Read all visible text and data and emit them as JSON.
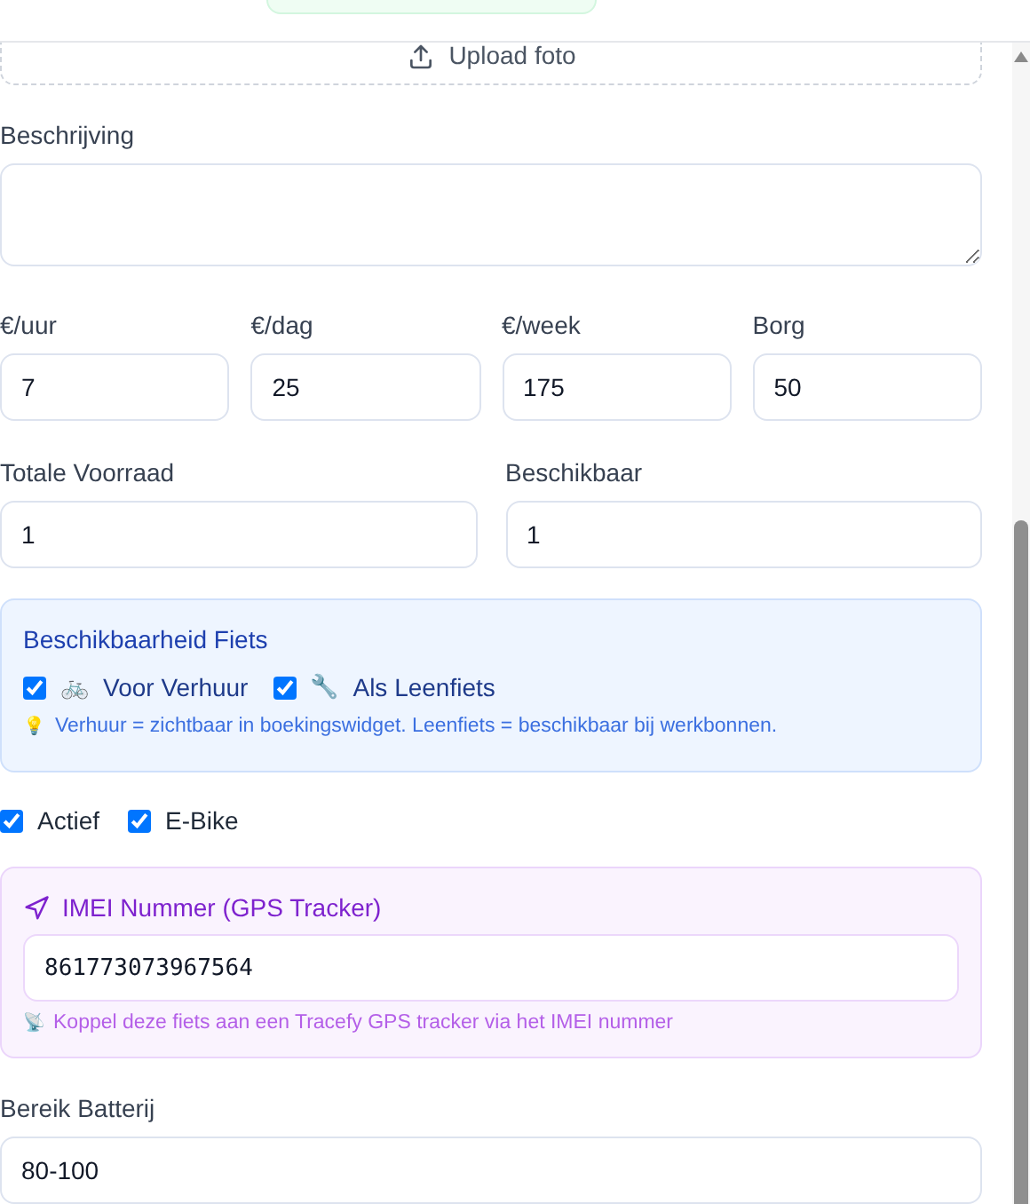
{
  "upload": {
    "label": "Upload foto"
  },
  "description": {
    "label": "Beschrijving"
  },
  "prices": [
    {
      "label": "€/uur",
      "value": "7"
    },
    {
      "label": "€/dag",
      "value": "25"
    },
    {
      "label": "€/week",
      "value": "175"
    },
    {
      "label": "Borg",
      "value": "50"
    }
  ],
  "stock": [
    {
      "label": "Totale Voorraad",
      "value": "1"
    },
    {
      "label": "Beschikbaar",
      "value": "1"
    }
  ],
  "availability": {
    "title": "Beschikbaarheid Fiets",
    "options": [
      {
        "icon": "🚲",
        "label": "Voor Verhuur",
        "checked": true
      },
      {
        "icon": "🔧",
        "label": "Als Leenfiets",
        "checked": true
      }
    ],
    "hint_icon": "💡",
    "hint": "Verhuur = zichtbaar in boekingswidget. Leenfiets = beschikbaar bij werkbonnen."
  },
  "flags": [
    {
      "label": "Actief",
      "checked": true
    },
    {
      "label": "E-Bike",
      "checked": true
    }
  ],
  "imei": {
    "title": "IMEI Nummer (GPS Tracker)",
    "value": "861773073967564",
    "hint_icon": "📡",
    "hint": "Koppel deze fiets aan een Tracefy GPS tracker via het IMEI nummer"
  },
  "battery_range": {
    "label": "Bereik Batterij",
    "value": "80-100"
  }
}
